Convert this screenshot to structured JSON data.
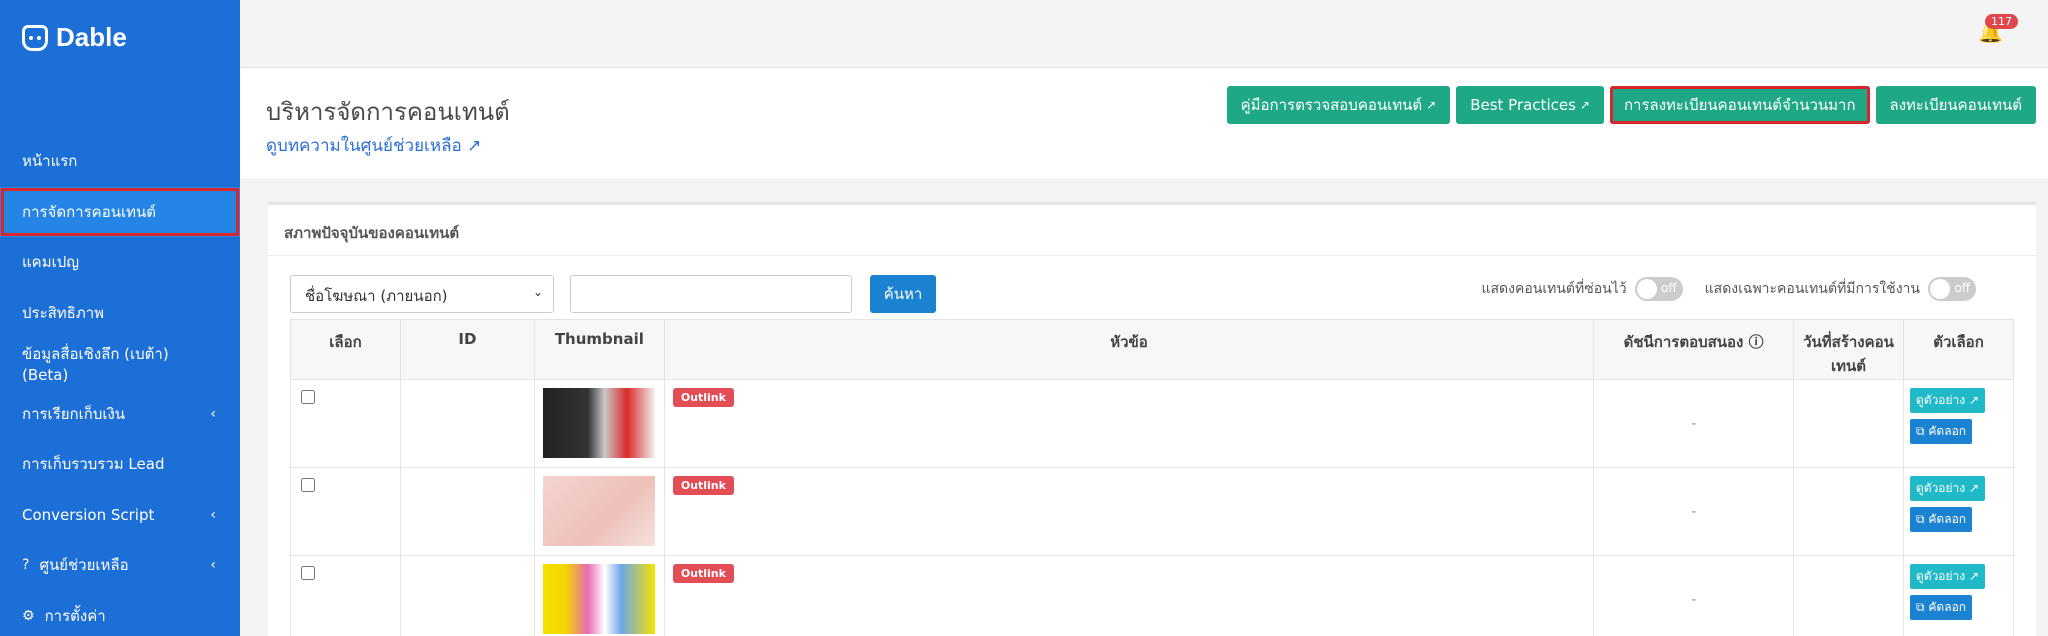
{
  "brand": {
    "name": "Dable"
  },
  "sidebar": {
    "items": [
      {
        "label": "หน้าแรก"
      },
      {
        "label": "การจัดการคอนเทนต์"
      },
      {
        "label": "แคมเปญ"
      },
      {
        "label": "ประสิทธิภาพ"
      },
      {
        "label": "ข้อมูลสื่อเชิงลึก (เบต้า) (Beta)"
      },
      {
        "label": "การเรียกเก็บเงิน"
      },
      {
        "label": "การเก็บรวบรวม Lead"
      },
      {
        "label": "Conversion Script"
      },
      {
        "label": "ศูนย์ช่วยเหลือ"
      },
      {
        "label": "การตั้งค่า"
      }
    ]
  },
  "header": {
    "notification_count": "117"
  },
  "page": {
    "title": "บริหารจัดการคอนเทนต์",
    "help_link": "ดูบทความในศูนย์ช่วยเหลือ",
    "buttons": {
      "guide": "คู่มือการตรวจสอบคอนเทนต์",
      "best_practices": "Best Practices",
      "bulk_register": "การลงทะเบียนคอนเทนต์จำนวนมาก",
      "register": "ลงทะเบียนคอนเทนต์"
    }
  },
  "panel": {
    "title": "สภาพปัจจุบันของคอนเทนต์",
    "filter_select": "ชื่อโฆษณา (ภายนอก)",
    "search_button": "ค้นหา",
    "toggle_hidden_label": "แสดงคอนเทนต์ที่ซ่อนไว้",
    "toggle_active_label": "แสดงเฉพาะคอนเทนต์ที่มีการใช้งาน",
    "toggle_state": "off",
    "columns": {
      "select": "เลือก",
      "id": "ID",
      "thumbnail": "Thumbnail",
      "title": "หัวข้อ",
      "response_index": "ดัชนีการตอบสนอง",
      "created_date": "วันที่สร้างคอนเทนต์",
      "options": "ตัวเลือก"
    },
    "rows": [
      {
        "tag": "Outlink",
        "response": "-",
        "preview": "ดูตัวอย่าง",
        "copy": "คัดลอก"
      },
      {
        "tag": "Outlink",
        "response": "-",
        "preview": "ดูตัวอย่าง",
        "copy": "คัดลอก"
      },
      {
        "tag": "Outlink",
        "response": "-",
        "preview": "ดูตัวอย่าง",
        "copy": "คัดลอก"
      }
    ]
  }
}
